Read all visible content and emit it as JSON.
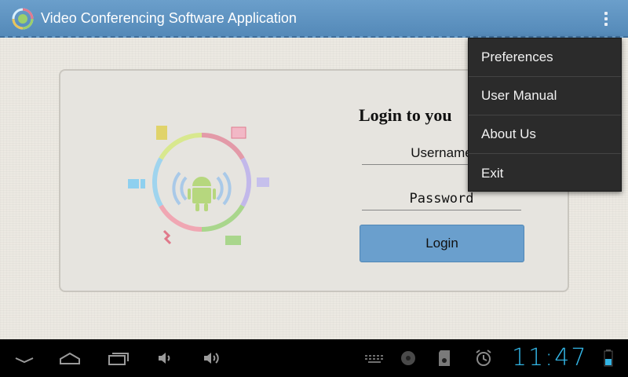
{
  "app": {
    "title": "Video Conferencing Software Application",
    "icon": "app-logo-icon"
  },
  "header": {
    "overflow_icon": "overflow-menu-icon"
  },
  "login": {
    "heading": "Login to you",
    "username_placeholder": "Username",
    "password_placeholder": "Password",
    "button_label": "Login"
  },
  "menu": {
    "items": [
      {
        "label": "Preferences"
      },
      {
        "label": "User Manual"
      },
      {
        "label": "About Us"
      },
      {
        "label": "Exit"
      }
    ]
  },
  "system_bar": {
    "time": "11:47",
    "icons": [
      "back-icon",
      "home-icon",
      "recent-apps-icon",
      "volume-down-icon",
      "volume-up-icon",
      "keyboard-icon",
      "record-icon",
      "sd-card-icon",
      "alarm-icon",
      "battery-icon"
    ]
  },
  "colors": {
    "action_bar": "#5d91c0",
    "accent": "#6a9fcd",
    "clock": "#33b5e5",
    "menu_bg": "#2b2b2b"
  }
}
